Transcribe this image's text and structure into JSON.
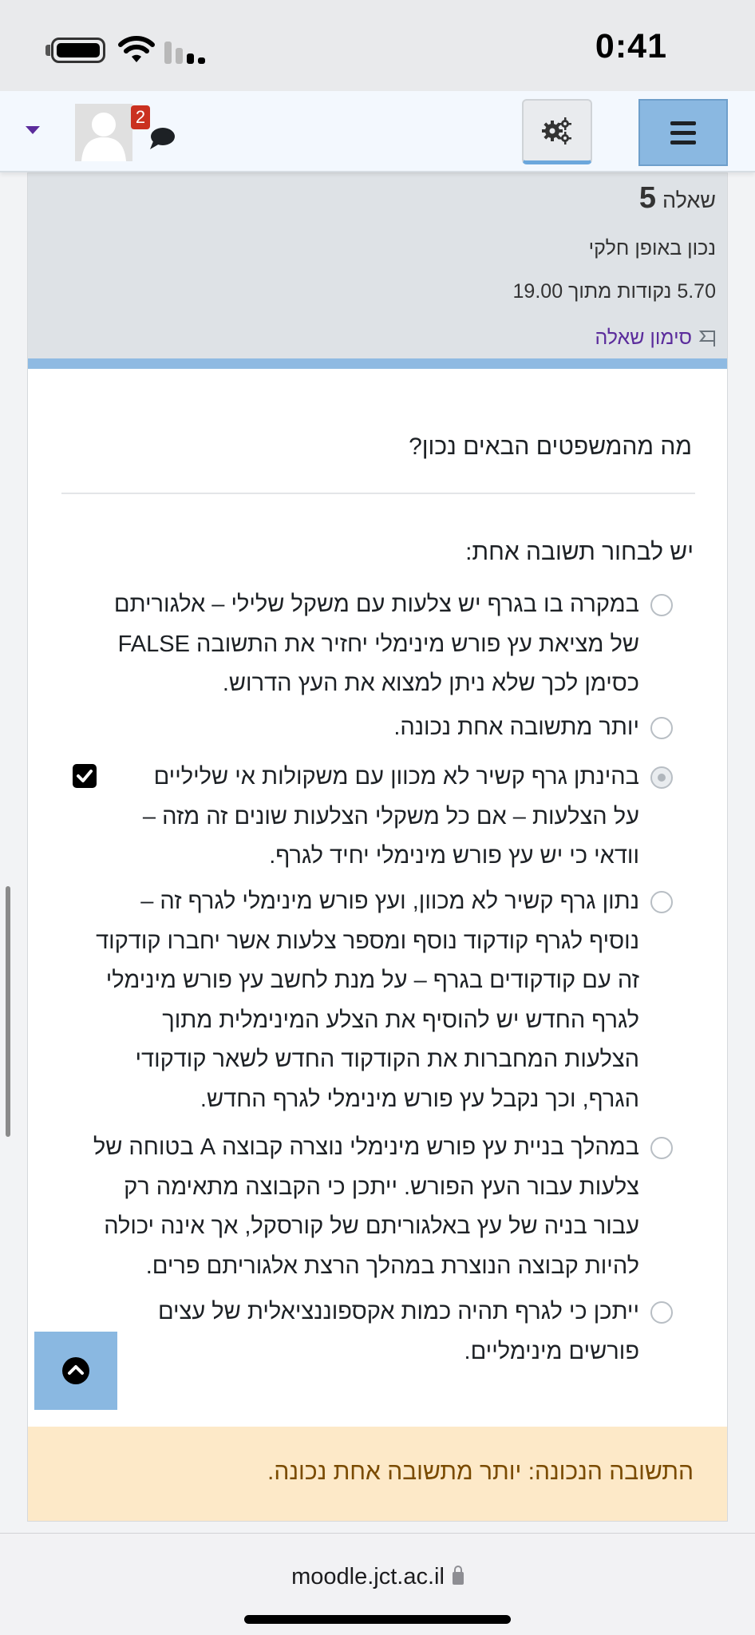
{
  "status_bar": {
    "time": "0:41"
  },
  "navbar": {
    "notification_count": "2"
  },
  "question_info": {
    "label": "שאלה",
    "number": "5",
    "state": "נכון באופן חלקי",
    "grade": "5.70 נקודות מתוך 19.00",
    "flag_label": "סימון שאלה"
  },
  "question": {
    "text": "מה מהמשפטים הבאים נכון?",
    "prompt": "יש לבחור תשובה אחת:",
    "selected_index": 2,
    "answers": [
      {
        "lines": [
          "במקרה בו בגרף יש צלעות עם משקל שלילי – אלגוריתם",
          "של מציאת עץ פורש מינימלי יחזיר את התשובה FALSE",
          "כסימן לכך שלא ניתן למצוא את העץ הדרוש."
        ]
      },
      {
        "lines": [
          "יותר מתשובה אחת נכונה."
        ]
      },
      {
        "lines": [
          "בהינתן גרף קשיר לא מכוון עם משקולות אי שליליים",
          "על הצלעות – אם כל משקלי הצלעות שונים זה מזה –",
          "וודאי כי יש עץ פורש מינימלי יחיד לגרף."
        ]
      },
      {
        "lines": [
          "נתון גרף קשיר לא מכוון, ועץ פורש מינימלי לגרף זה –",
          "נוסיף לגרף קודקוד נוסף ומספר צלעות אשר יחברו קודקוד",
          "זה עם קודקודים בגרף – על מנת לחשב עץ פורש מינימלי",
          "לגרף החדש יש להוסיף את הצלע המינימלית מתוך",
          "הצלעות המחברות את הקודקוד החדש לשאר קודקודי",
          "הגרף, וכך נקבל עץ פורש מינימלי לגרף החדש."
        ]
      },
      {
        "lines": [
          "במהלך בניית עץ פורש מינימלי נוצרה קבוצה A בטוחה של",
          "צלעות עבור העץ הפורש. ייתכן כי הקבוצה מתאימה רק",
          "עבור בניה של עץ באלגוריתם של קורסקל, אך אינה יכולה",
          "להיות קבוצה הנוצרת במהלך הרצת אלגוריתם פרים."
        ]
      },
      {
        "lines": [
          "ייתכן כי לגרף תהיה כמות אקספוננציאלית של עצים",
          "פורשים מינימליים."
        ]
      }
    ]
  },
  "feedback": {
    "text": "התשובה הנכונה: יותר מתשובה אחת נכונה."
  },
  "browser": {
    "url": "moodle.jct.ac.il"
  }
}
